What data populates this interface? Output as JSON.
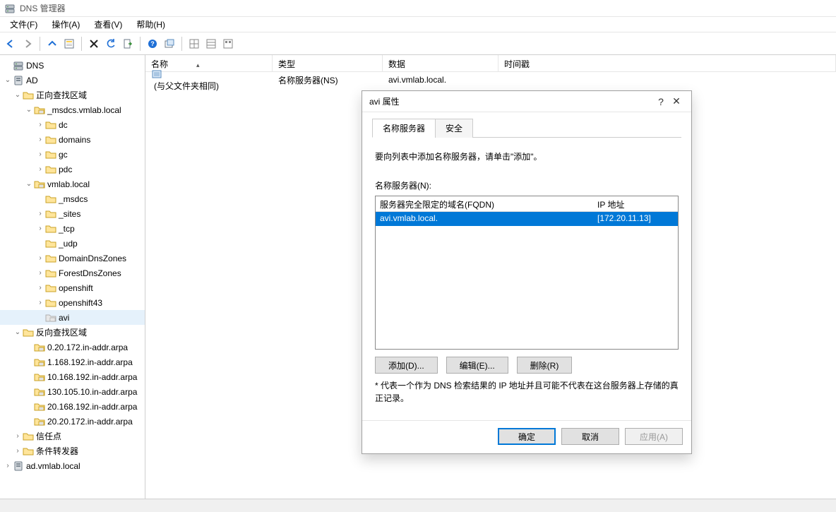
{
  "window": {
    "title": "DNS 管理器"
  },
  "menu": {
    "file": "文件(F)",
    "action": "操作(A)",
    "view": "查看(V)",
    "help": "帮助(H)"
  },
  "tree": {
    "root": "DNS",
    "server": "AD",
    "fwdzone": "正向查找区域",
    "msdcs": "_msdcs.vmlab.local",
    "dc": "dc",
    "domains": "domains",
    "gc": "gc",
    "pdc": "pdc",
    "vmlab": "vmlab.local",
    "msdcs2": "_msdcs",
    "sites": "_sites",
    "tcp": "_tcp",
    "udp": "_udp",
    "domaindns": "DomainDnsZones",
    "forestdns": "ForestDnsZones",
    "openshift": "openshift",
    "openshift43": "openshift43",
    "avi": "avi",
    "revzone": "反向查找区域",
    "r0": "0.20.172.in-addr.arpa",
    "r1": "1.168.192.in-addr.arpa",
    "r2": "10.168.192.in-addr.arpa",
    "r3": "130.105.10.in-addr.arpa",
    "r4": "20.168.192.in-addr.arpa",
    "r5": "20.20.172.in-addr.arpa",
    "trust": "信任点",
    "cond": "条件转发器",
    "advmlab": "ad.vmlab.local"
  },
  "list": {
    "hdr_name": "名称",
    "hdr_type": "类型",
    "hdr_data": "数据",
    "hdr_ts": "时间戳",
    "row0_name": "(与父文件夹相同)",
    "row0_type": "名称服务器(NS)",
    "row0_data": "avi.vmlab.local."
  },
  "dialog": {
    "title": "avi 属性",
    "tab_ns": "名称服务器",
    "tab_sec": "安全",
    "hint": "要向列表中添加名称服务器，请单击\"添加\"。",
    "ns_label": "名称服务器(N):",
    "col_fqdn": "服务器完全限定的域名(FQDN)",
    "col_ip": "IP 地址",
    "row_fqdn": "avi.vmlab.local.",
    "row_ip": "[172.20.11.13]",
    "btn_add": "添加(D)...",
    "btn_edit": "编辑(E)...",
    "btn_del": "删除(R)",
    "note": "* 代表一个作为 DNS 检索结果的 IP 地址并且可能不代表在这台服务器上存储的真正记录。",
    "ok": "确定",
    "cancel": "取消",
    "apply": "应用(A)"
  }
}
